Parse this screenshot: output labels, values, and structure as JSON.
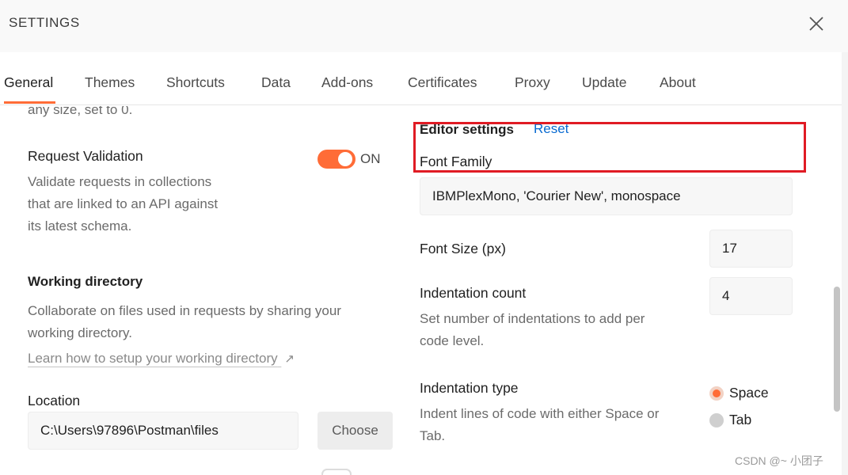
{
  "window": {
    "title": "SETTINGS"
  },
  "tabs": [
    {
      "label": "General"
    },
    {
      "label": "Themes"
    },
    {
      "label": "Shortcuts"
    },
    {
      "label": "Data"
    },
    {
      "label": "Add-ons"
    },
    {
      "label": "Certificates"
    },
    {
      "label": "Proxy"
    },
    {
      "label": "Update"
    },
    {
      "label": "About"
    }
  ],
  "general": {
    "truncated_text": "any size, set to 0.",
    "request_validation": {
      "label": "Request Validation",
      "toggle_state": "ON",
      "desc_lines": [
        "Validate requests in collections",
        "that are linked to an API against",
        "its latest schema."
      ]
    },
    "working_directory": {
      "heading": "Working directory",
      "desc_lines": [
        "Collaborate on files used in requests by sharing your",
        "working directory."
      ],
      "link": "Learn how to setup your working directory",
      "link_icon": "↗"
    },
    "location": {
      "label": "Location",
      "value": "C:\\Users\\97896\\Postman\\files",
      "choose_label": "Choose"
    }
  },
  "editor": {
    "heading": "Editor settings",
    "reset_label": "Reset",
    "font_family": {
      "label": "Font Family",
      "value": "IBMPlexMono, 'Courier New', monospace"
    },
    "font_size": {
      "label": "Font Size (px)",
      "value": "17"
    },
    "indentation_count": {
      "label": "Indentation count",
      "value": "4",
      "desc_lines": [
        "Set number of indentations to add per",
        "code level."
      ]
    },
    "indentation_type": {
      "label": "Indentation type",
      "desc_lines": [
        "Indent lines of code with either Space or",
        "Tab."
      ],
      "options": [
        {
          "label": "Space",
          "selected": true
        },
        {
          "label": "Tab",
          "selected": false
        }
      ]
    }
  },
  "watermark": "CSDN @~ 小团子",
  "colors": {
    "accent": "#ff6c37",
    "link": "#0a6bd1",
    "highlight": "#e01b24"
  }
}
